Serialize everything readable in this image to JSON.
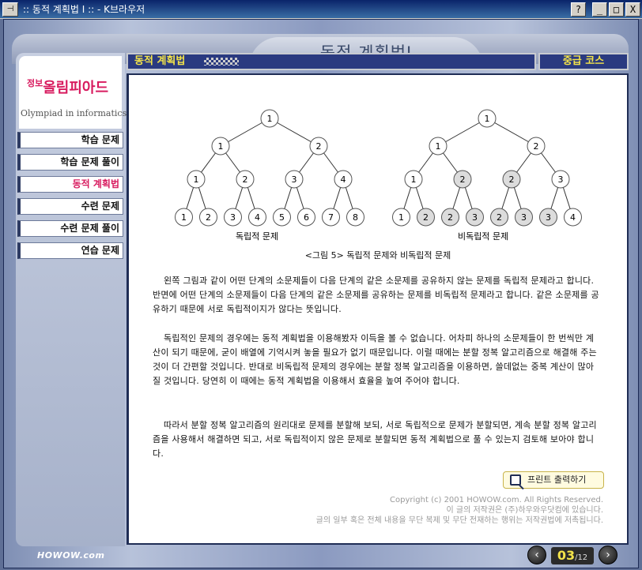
{
  "window": {
    "title": ":: 동적 계획법 I :: - K브라우저",
    "buttons": {
      "help": "?",
      "minimize": "_",
      "maximize": "□",
      "close": "X"
    }
  },
  "header": {
    "page_title": "동적 계획법I"
  },
  "logo": {
    "main": "올림피아드",
    "prefix": "정보",
    "sub": "Olympiad in informatics"
  },
  "nav": {
    "items": [
      {
        "label": "학습 문제",
        "active": false
      },
      {
        "label": "학습 문제 풀이",
        "active": false
      },
      {
        "label": "동적 계획법",
        "active": true
      },
      {
        "label": "수련 문제",
        "active": false
      },
      {
        "label": "수련 문제 풀이",
        "active": false
      },
      {
        "label": "연습 문제",
        "active": false
      }
    ]
  },
  "section": {
    "title": "동적 계획법",
    "course": "중급 코스"
  },
  "figure": {
    "left_label": "독립적 문제",
    "right_label": "비독립적 문제",
    "caption": "<그림 5> 독립적 문제와 비독립적 문제",
    "left_tree": [
      "1",
      "1",
      "2",
      "1",
      "2",
      "3",
      "4",
      "1",
      "2",
      "3",
      "4",
      "5",
      "6",
      "7",
      "8"
    ],
    "right_tree": [
      "1",
      "1",
      "2",
      "1",
      "2",
      "2",
      "3",
      "1",
      "2",
      "2",
      "3",
      "2",
      "3",
      "3",
      "4"
    ],
    "right_highlight": [
      false,
      false,
      false,
      false,
      true,
      true,
      false,
      false,
      true,
      true,
      true,
      true,
      true,
      true,
      false
    ]
  },
  "body": {
    "p1": "왼쪽 그림과 같이 어떤 단계의 소문제들이 다음 단계의 같은 소문제를 공유하지 않는 문제를 독립적 문제라고 합니다. 반면에 어떤 단계의 소문제들이 다음 단계의 같은 소문제를 공유하는 문제를 비독립적 문제라고 합니다. 같은 소문제를 공유하기 때문에 서로 독립적이지가 않다는 뜻입니다.",
    "p2": "독립적인 문제의 경우에는 동적 계획법을 이용해봤자 이득을 볼 수 없습니다. 어차피 하나의 소문제들이 한 번씩만 계산이 되기 때문에, 굳이 배열에 기억시켜 놓을 필요가 없기 때문입니다. 이럴 때에는 분할 정복 알고리즘으로 해결해 주는 것이 더 간편할 것입니다. 반대로 비독립적 문제의 경우에는 분할 정복 알고리즘을 이용하면, 쓸데없는 중복 계산이 많아질 것입니다. 당연히 이 때에는 동적 계획법을 이용해서 효율을 높여 주어야 합니다.",
    "p3": "따라서 분할 정복 알고리즘의 원리대로 문제를 분할해 보되, 서로 독립적으로 문제가 분할되면, 계속 분할 정복 알고리즘을 사용해서 해결하면 되고, 서로 독립적이지 않은 문제로 분할되면 동적 계획법으로 풀 수 있는지 검토해 보아야 합니다."
  },
  "print_button": {
    "label": "프린트 출력하기"
  },
  "copyright": {
    "line1": "Copyright (c) 2001 HOWOW.com. All Rights Reserved.",
    "line2": "이 글의 저작권은 (주)하우와우닷컴에 있습니다.",
    "line3": "글의 일부 혹은 전체 내용을 무단 복제 및 무단 전재하는 행위는 저작권법에 저촉됩니다."
  },
  "footer": {
    "logo": "HOWOW.com",
    "prev": "‹",
    "next": "›",
    "current_page": "03",
    "total_pages": "/12"
  }
}
